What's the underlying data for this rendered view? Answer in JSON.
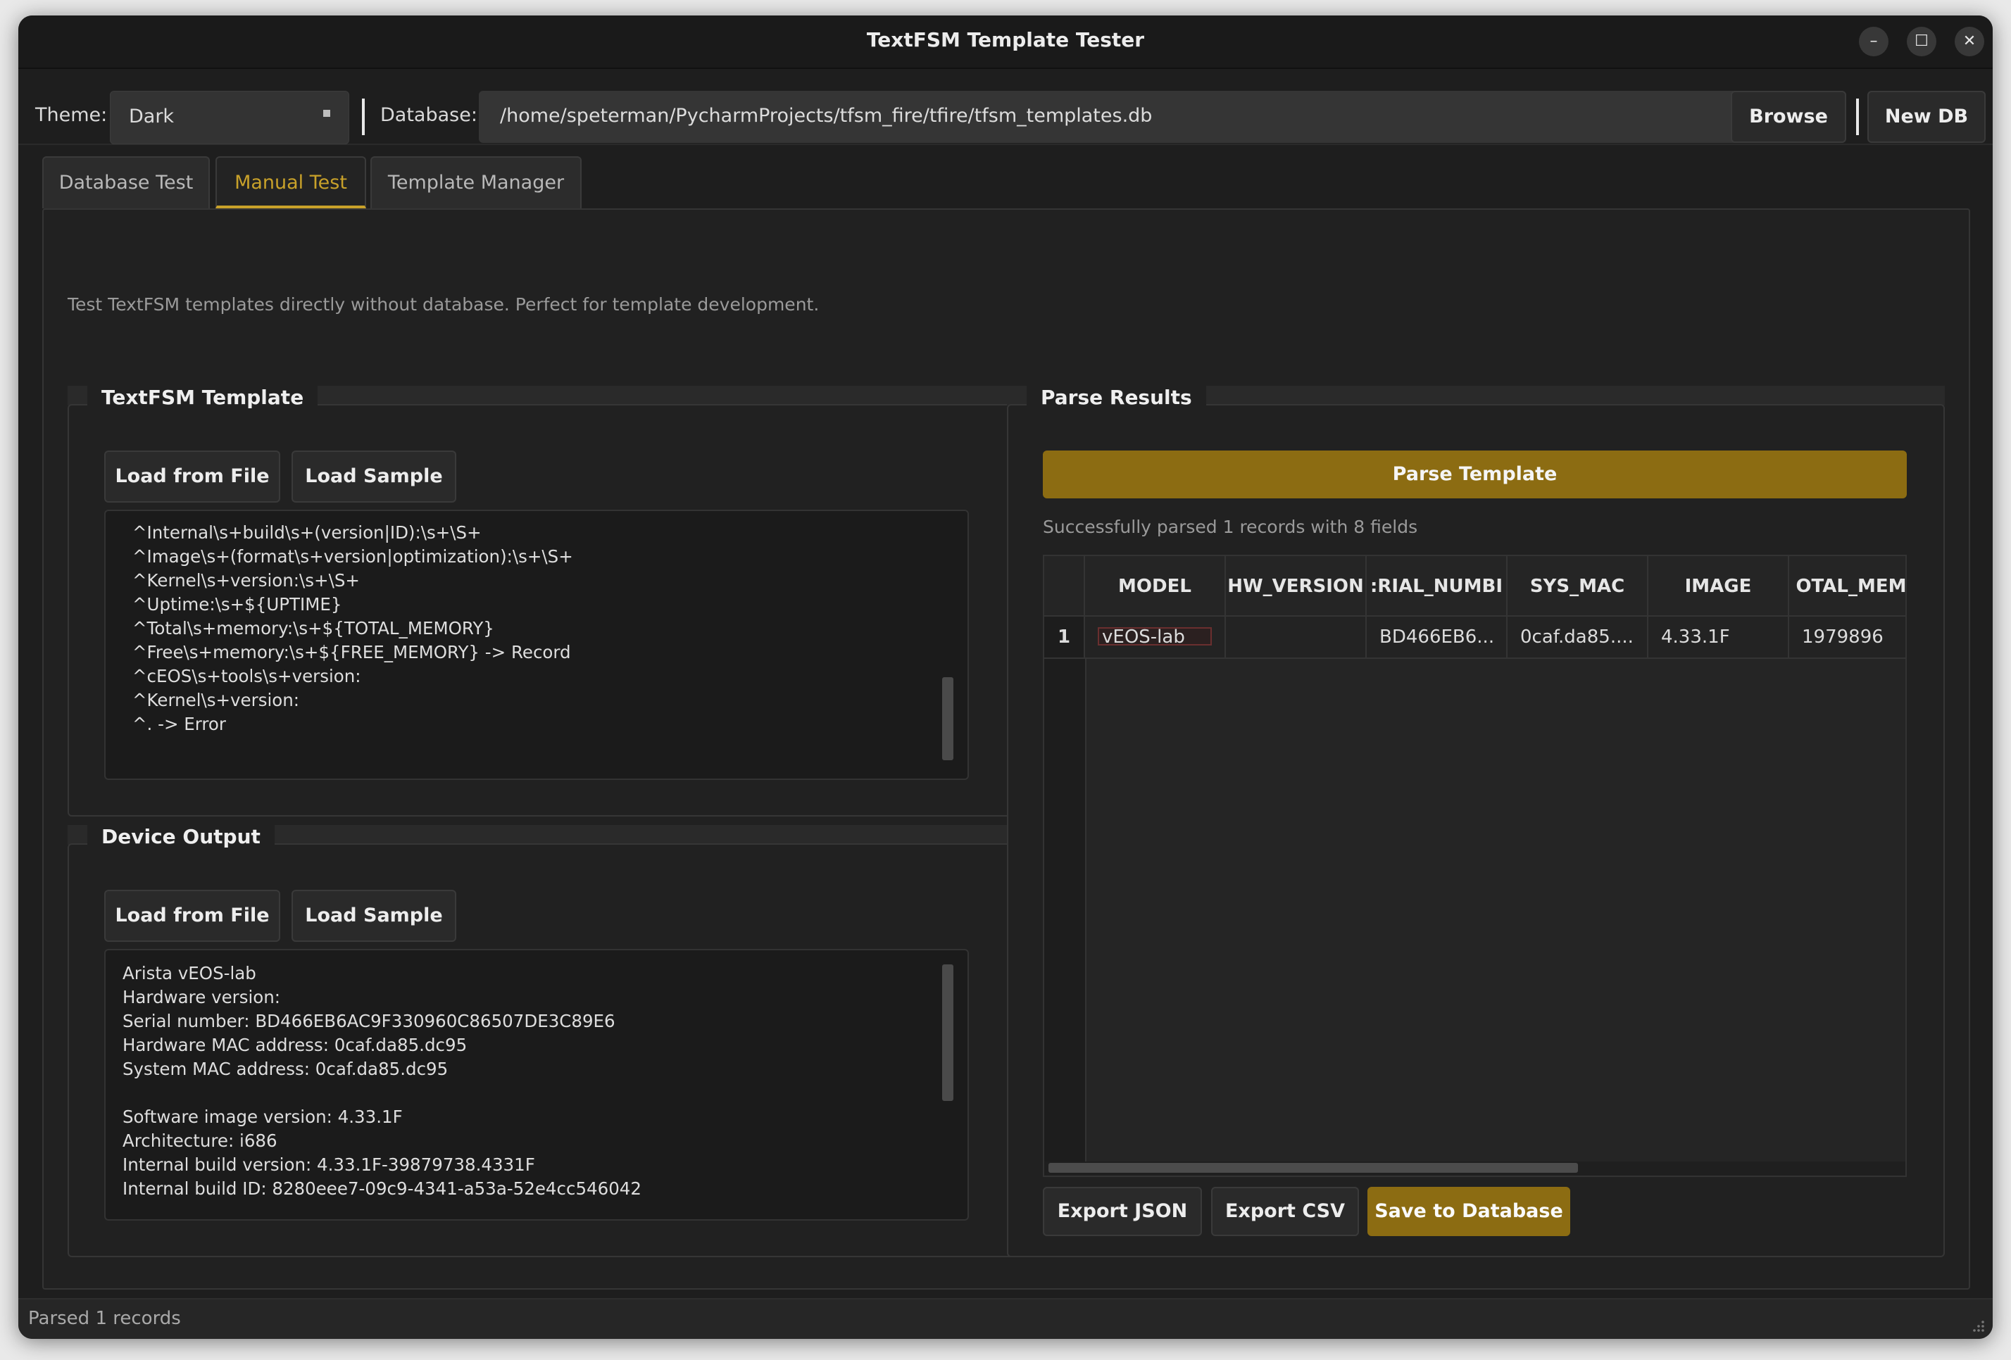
{
  "window": {
    "title": "TextFSM Template Tester"
  },
  "toolbar": {
    "theme_label": "Theme:",
    "theme_value": "Dark",
    "database_label": "Database:",
    "database_path": "/home/speterman/PycharmProjects/tfsm_fire/tfire/tfsm_templates.db",
    "browse_label": "Browse",
    "new_db_label": "New DB"
  },
  "tabs": [
    {
      "label": "Database Test"
    },
    {
      "label": "Manual Test",
      "active": true
    },
    {
      "label": "Template Manager"
    }
  ],
  "manual": {
    "hint": "Test TextFSM templates directly without database. Perfect for template development.",
    "template_group": {
      "title": "TextFSM Template",
      "load_file_label": "Load from File",
      "load_sample_label": "Load Sample",
      "lines": [
        "^Internal\\s+build\\s+(version|ID):\\s+\\S+",
        "^Image\\s+(format\\s+version|optimization):\\s+\\S+",
        "^Kernel\\s+version:\\s+\\S+",
        "^Uptime:\\s+${UPTIME}",
        "^Total\\s+memory:\\s+${TOTAL_MEMORY}",
        "^Free\\s+memory:\\s+${FREE_MEMORY} -> Record",
        "^cEOS\\s+tools\\s+version:",
        "^Kernel\\s+version:",
        "^. -> Error"
      ]
    },
    "output_group": {
      "title": "Device Output",
      "load_file_label": "Load from File",
      "load_sample_label": "Load Sample",
      "lines": [
        "Arista vEOS-lab",
        "Hardware version:",
        "Serial number: BD466EB6AC9F330960C86507DE3C89E6",
        "Hardware MAC address: 0caf.da85.dc95",
        "System MAC address: 0caf.da85.dc95",
        "",
        "Software image version: 4.33.1F",
        "Architecture: i686",
        "Internal build version: 4.33.1F-39879738.4331F",
        "Internal build ID: 8280eee7-09c9-4341-a53a-52e4cc546042"
      ]
    },
    "results_group": {
      "title": "Parse Results",
      "parse_label": "Parse Template",
      "status": "Successfully parsed 1 records with 8 fields",
      "columns": [
        "MODEL",
        "HW_VERSION",
        ":RIAL_NUMBI",
        "SYS_MAC",
        "IMAGE",
        "OTAL_MEMO"
      ],
      "row_number": "1",
      "row": [
        "vEOS-lab",
        "",
        "BD466EB6...",
        "0caf.da85....",
        "4.33.1F",
        "1979896"
      ],
      "export_json_label": "Export JSON",
      "export_csv_label": "Export CSV",
      "save_db_label": "Save to Database"
    }
  },
  "statusbar": {
    "text": "Parsed 1 records"
  },
  "colors": {
    "accent": "#c8a12a",
    "button_gold": "#8c6c12",
    "background": "#1e1e1e"
  }
}
